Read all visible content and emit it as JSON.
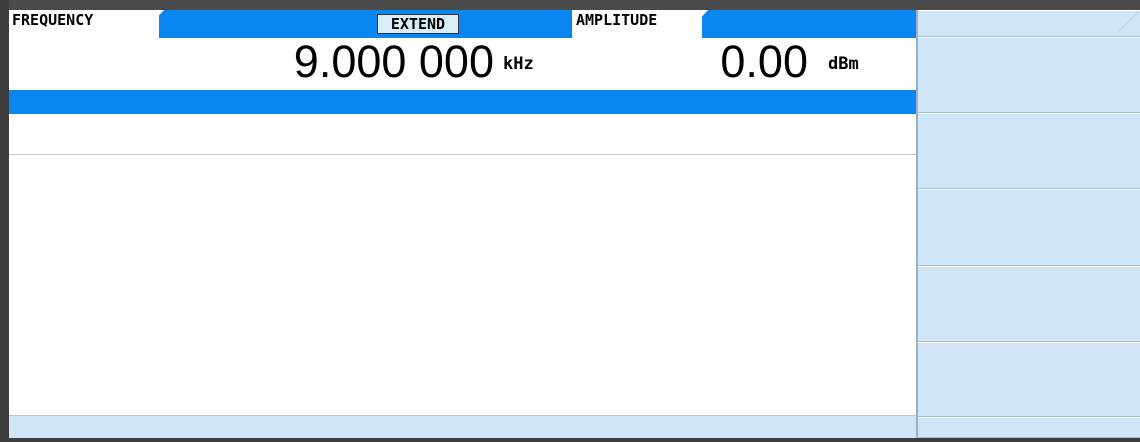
{
  "frequency": {
    "label": "FREQUENCY",
    "mode_badge": "EXTEND",
    "value": "9.000 000",
    "unit": "kHz"
  },
  "amplitude": {
    "label": "AMPLITUDE",
    "value": "0.00",
    "unit": "dBm"
  },
  "colors": {
    "header_blue": "#0a86f0",
    "softkey_blue": "#cfe6f8",
    "frame_dark": "#3d3d3d"
  },
  "softkeys": [
    {
      "label": ""
    },
    {
      "label": ""
    },
    {
      "label": ""
    },
    {
      "label": ""
    },
    {
      "label": ""
    },
    {
      "label": ""
    }
  ]
}
